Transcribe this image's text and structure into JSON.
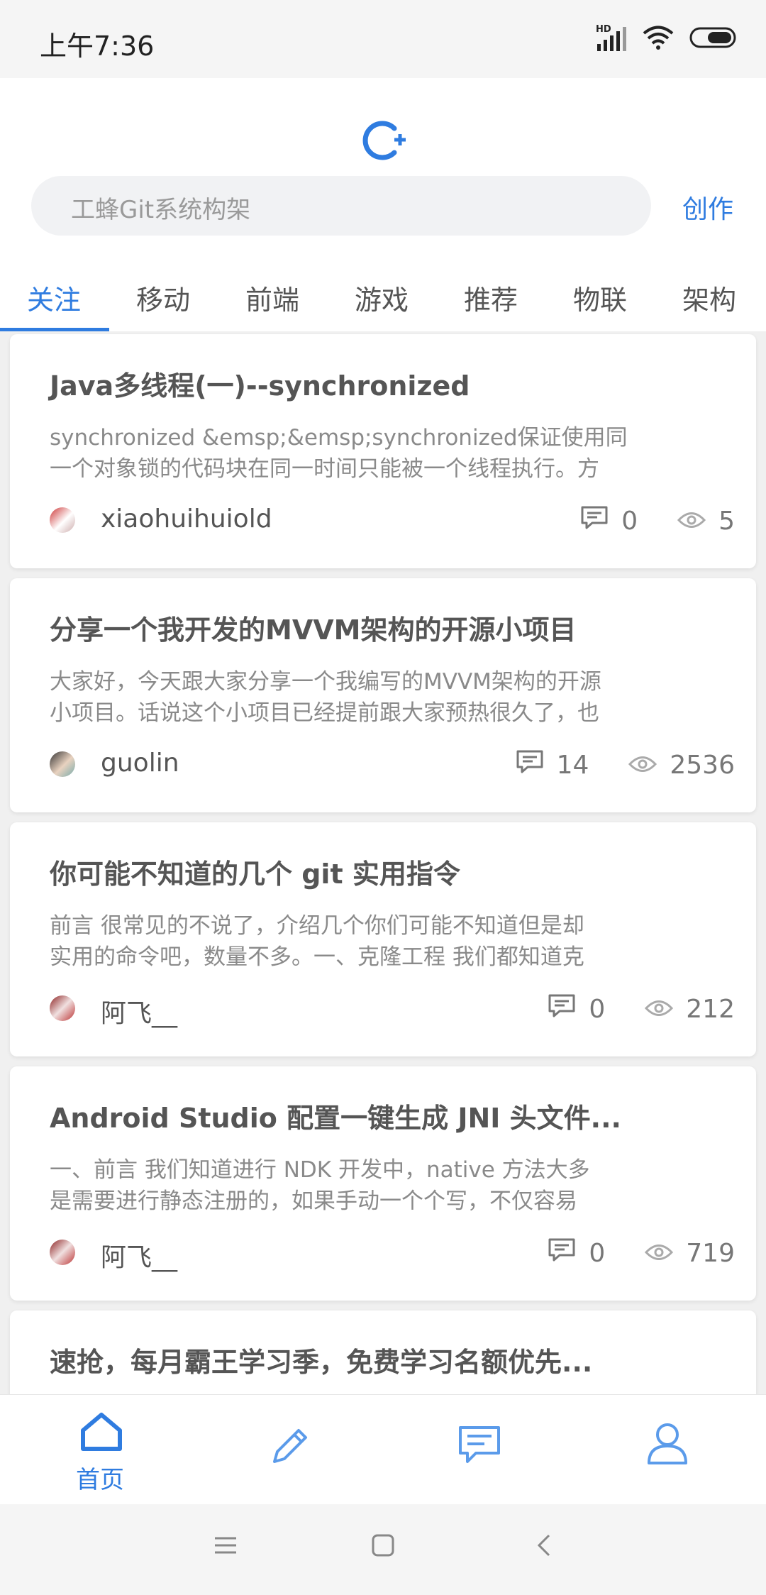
{
  "status_bar": {
    "time": "上午7:36",
    "network": "HD"
  },
  "header": {
    "search_placeholder": "工蜂Git系统构架",
    "create_label": "创作",
    "tabs": [
      {
        "label": "关注",
        "active": true
      },
      {
        "label": "移动"
      },
      {
        "label": "前端"
      },
      {
        "label": "游戏"
      },
      {
        "label": "推荐"
      },
      {
        "label": "物联"
      },
      {
        "label": "架构"
      }
    ]
  },
  "feed": {
    "articles": [
      {
        "title": "Java多线程(一)--synchronized",
        "excerpt_line1": "synchronized &emsp;&emsp;synchronized保证使用同",
        "excerpt_line2": "一个对象锁的代码块在同一时间只能被一个线程执行。方",
        "author": "xiaohuihuiold",
        "comments": "0",
        "views": "5"
      },
      {
        "title": "分享一个我开发的MVVM架构的开源小项目",
        "excerpt_line1": "大家好，今天跟大家分享一个我编写的MVVM架构的开源",
        "excerpt_line2": "小项目。话说这个小项目已经提前跟大家预热很久了，也",
        "author": "guolin",
        "comments": "14",
        "views": "2536"
      },
      {
        "title": "你可能不知道的几个 git 实用指令",
        "excerpt_line1": "前言 很常见的不说了，介绍几个你们可能不知道但是却",
        "excerpt_line2": "实用的命令吧，数量不多。一、克隆工程 我们都知道克",
        "author": "阿飞__",
        "comments": "0",
        "views": "212"
      },
      {
        "title": "Android Studio 配置一键生成 JNI 头文件...",
        "excerpt_line1": "一、前言 我们知道进行 NDK 开发中，native 方法大多",
        "excerpt_line2": "是需要进行静态注册的，如果手动一个个写，不仅容易",
        "author": "阿飞__",
        "comments": "0",
        "views": "719"
      },
      {
        "title": "速抢，每月霸王学习季，免费学习名额优先..."
      }
    ]
  },
  "bottom_nav": {
    "home_label": "首页",
    "items": [
      "home-icon",
      "pencil-icon",
      "message-icon",
      "user-icon"
    ]
  },
  "colors": {
    "accent": "#2f7ce0",
    "nav_icon": "#5b9bea"
  }
}
